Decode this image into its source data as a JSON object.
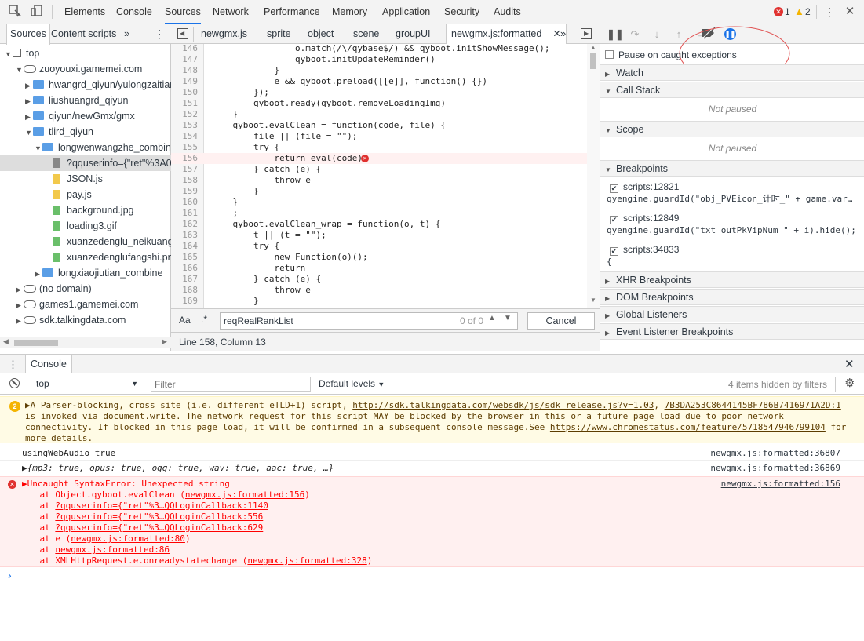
{
  "toolbar": {
    "tabs": [
      "Elements",
      "Console",
      "Sources",
      "Network",
      "Performance",
      "Memory",
      "Application",
      "Security",
      "Audits"
    ],
    "active_tab": "Sources",
    "error_count": "1",
    "warning_count": "2"
  },
  "navigator": {
    "tabs": [
      "Sources",
      "Content scripts"
    ],
    "tree": [
      {
        "label": "top",
        "type": "top"
      },
      {
        "label": "zuoyouxi.gamemei.com",
        "type": "cloud"
      },
      {
        "label": "hwangrd_qiyun/yulongzaitian",
        "type": "folder"
      },
      {
        "label": "liushuangrd_qiyun",
        "type": "folder"
      },
      {
        "label": "qiyun/newGmx/gmx",
        "type": "folder"
      },
      {
        "label": "tlird_qiyun",
        "type": "folder"
      },
      {
        "label": "longwenwangzhe_combine",
        "type": "folder"
      },
      {
        "label": "?qquserinfo={\"ret\"%3A0",
        "type": "file-gray"
      },
      {
        "label": "JSON.js",
        "type": "file-yellow"
      },
      {
        "label": "pay.js",
        "type": "file-yellow"
      },
      {
        "label": "background.jpg",
        "type": "file-green"
      },
      {
        "label": "loading3.gif",
        "type": "file-green"
      },
      {
        "label": "xuanzedenglu_neikuang.",
        "type": "file-green"
      },
      {
        "label": "xuanzedenglufangshi.pn",
        "type": "file-green"
      },
      {
        "label": "longxiaojiutian_combine",
        "type": "folder"
      },
      {
        "label": "(no domain)",
        "type": "cloud"
      },
      {
        "label": "games1.gamemei.com",
        "type": "cloud"
      },
      {
        "label": "sdk.talkingdata.com",
        "type": "cloud"
      }
    ]
  },
  "editor": {
    "tabs": [
      "newgmx.js",
      "sprite",
      "object",
      "scene",
      "groupUI",
      "newgmx.js:formatted"
    ],
    "lines": [
      {
        "n": "146",
        "t": "                o.match(/\\/qybase$/) && qyboot.initShowMessage();"
      },
      {
        "n": "147",
        "t": "                qyboot.initUpdateReminder()"
      },
      {
        "n": "148",
        "t": "            }"
      },
      {
        "n": "149",
        "t": "            e && qyboot.preload([[e]], function() {})"
      },
      {
        "n": "150",
        "t": "        });"
      },
      {
        "n": "151",
        "t": "        qyboot.ready(qyboot.removeLoadingImg)"
      },
      {
        "n": "152",
        "t": "    }"
      },
      {
        "n": "153",
        "t": "    qyboot.evalClean = function(code, file) {"
      },
      {
        "n": "154",
        "t": "        file || (file = \"\");"
      },
      {
        "n": "155",
        "t": "        try {"
      },
      {
        "n": "156",
        "t": "            return eval(code)"
      },
      {
        "n": "157",
        "t": "        } catch (e) {"
      },
      {
        "n": "158",
        "t": "            throw e"
      },
      {
        "n": "159",
        "t": "        }"
      },
      {
        "n": "160",
        "t": "    }"
      },
      {
        "n": "161",
        "t": "    ;"
      },
      {
        "n": "162",
        "t": "    qyboot.evalClean_wrap = function(o, t) {"
      },
      {
        "n": "163",
        "t": "        t || (t = \"\");"
      },
      {
        "n": "164",
        "t": "        try {"
      },
      {
        "n": "165",
        "t": "            new Function(o)();"
      },
      {
        "n": "166",
        "t": "            return"
      },
      {
        "n": "167",
        "t": "        } catch (e) {"
      },
      {
        "n": "168",
        "t": "            throw e"
      },
      {
        "n": "169",
        "t": "        }"
      }
    ],
    "search": {
      "case_label": "Aa",
      "regex_label": ".*",
      "query": "reqRealRankList",
      "count": "0 of 0",
      "cancel_label": "Cancel"
    },
    "status": "Line 158, Column 13"
  },
  "sidebar": {
    "pause_exceptions_label": "Pause on caught exceptions",
    "sections": {
      "watch": "Watch",
      "call_stack": "Call Stack",
      "scope": "Scope",
      "breakpoints": "Breakpoints",
      "xhr": "XHR Breakpoints",
      "dom": "DOM Breakpoints",
      "global": "Global Listeners",
      "event": "Event Listener Breakpoints"
    },
    "not_paused": "Not paused",
    "breakpoints": [
      {
        "location": "scripts:12821",
        "code": "qyengine.guardId(\"obj_PVEicon_计时_\" + game.var…"
      },
      {
        "location": "scripts:12849",
        "code": "qyengine.guardId(\"txt_outPkVipNum_\" + i).hide();"
      },
      {
        "location": "scripts:34833",
        "code": "{"
      }
    ]
  },
  "drawer": {
    "tab": "Console",
    "context": "top",
    "filter_placeholder": "Filter",
    "levels": "Default levels",
    "hidden": "4 items hidden by filters"
  },
  "console": {
    "warn_count": "2",
    "warning": {
      "line1": "▶A Parser-blocking, cross site (i.e. different eTLD+1) script, ",
      "url": "http://sdk.talkingdata.com/websdk/js/sdk_release.js?v=1.03",
      "url2": "7B3DA253C8644145BF786B7416971A2D:1",
      "line2": "is invoked via document.write. The network request for this script MAY be blocked by the browser in this or a future page load due to poor network",
      "line3": "connectivity. If blocked in this page load, it will be confirmed in a subsequent console message.See ",
      "url3": "https://www.chromestatus.com/feature/5718547946799104",
      "line3b": " for",
      "line4": "more details."
    },
    "log1": {
      "text": "usingWebAudio true",
      "src": "newgmx.js:formatted:36807"
    },
    "log2": {
      "text": "▶{mp3: true, opus: true, ogg: true, wav: true, aac: true, …}",
      "src": "newgmx.js:formatted:36869"
    },
    "error": {
      "head": "▶Uncaught SyntaxError: Unexpected string",
      "src": "newgmx.js:formatted:156",
      "stack": [
        {
          "pre": "    at Object.qyboot.evalClean (",
          "link": "newgmx.js:formatted:156",
          "post": ")"
        },
        {
          "pre": "    at ",
          "link": "?qquserinfo={\"ret\"%3…QQLoginCallback:1140",
          "post": ""
        },
        {
          "pre": "    at ",
          "link": "?qquserinfo={\"ret\"%3…QQLoginCallback:556",
          "post": ""
        },
        {
          "pre": "    at ",
          "link": "?qquserinfo={\"ret\"%3…QQLoginCallback:629",
          "post": ""
        },
        {
          "pre": "    at e (",
          "link": "newgmx.js:formatted:80",
          "post": ")"
        },
        {
          "pre": "    at ",
          "link": "newgmx.js:formatted:86",
          "post": ""
        },
        {
          "pre": "    at XMLHttpRequest.e.onreadystatechange (",
          "link": "newgmx.js:formatted:328",
          "post": ")"
        }
      ]
    },
    "prompt": "›"
  },
  "colors": {
    "accent": "#1a73e8",
    "error": "#e0312f",
    "warning": "#f4b400",
    "annotation": "#e05050"
  }
}
